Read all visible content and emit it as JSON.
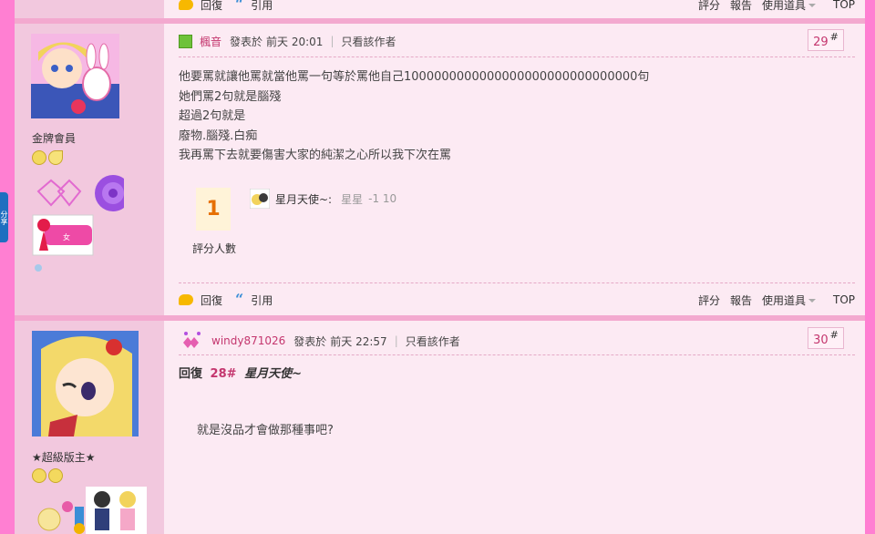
{
  "side_tab": "分享",
  "actions": {
    "reply": "回復",
    "quote": "引用",
    "rate": "評分",
    "report": "報告",
    "tools": "使用道具",
    "top": "TOP"
  },
  "posts": [
    {
      "author": "楓音",
      "posted_label": "發表於",
      "time": "前天 20:01",
      "only_author": "只看該作者",
      "floor": "29",
      "floor_mark": "#",
      "rank": "金牌會員",
      "content": [
        "他要罵就讓他罵就當他罵一句等於罵他自己1000000000000000000000000000000句",
        "她們罵2句就是腦殘",
        "超過2句就是",
        "廢物.腦殘.白痴",
        "我再罵下去就要傷害大家的純潔之心所以我下次在罵"
      ],
      "rating": {
        "count": "1",
        "label": "評分人數",
        "rater": "星月天使~:",
        "item": "星星",
        "score": "-1 10"
      }
    },
    {
      "author": "windy871026",
      "posted_label": "發表於",
      "time": "前天 22:57",
      "only_author": "只看該作者",
      "floor": "30",
      "floor_mark": "#",
      "rank": "★超級版主★",
      "reply_label": "回復",
      "reply_floor": "28#",
      "reply_to": "星月天使~",
      "content": "就是沒品才會做那種事吧?"
    }
  ]
}
